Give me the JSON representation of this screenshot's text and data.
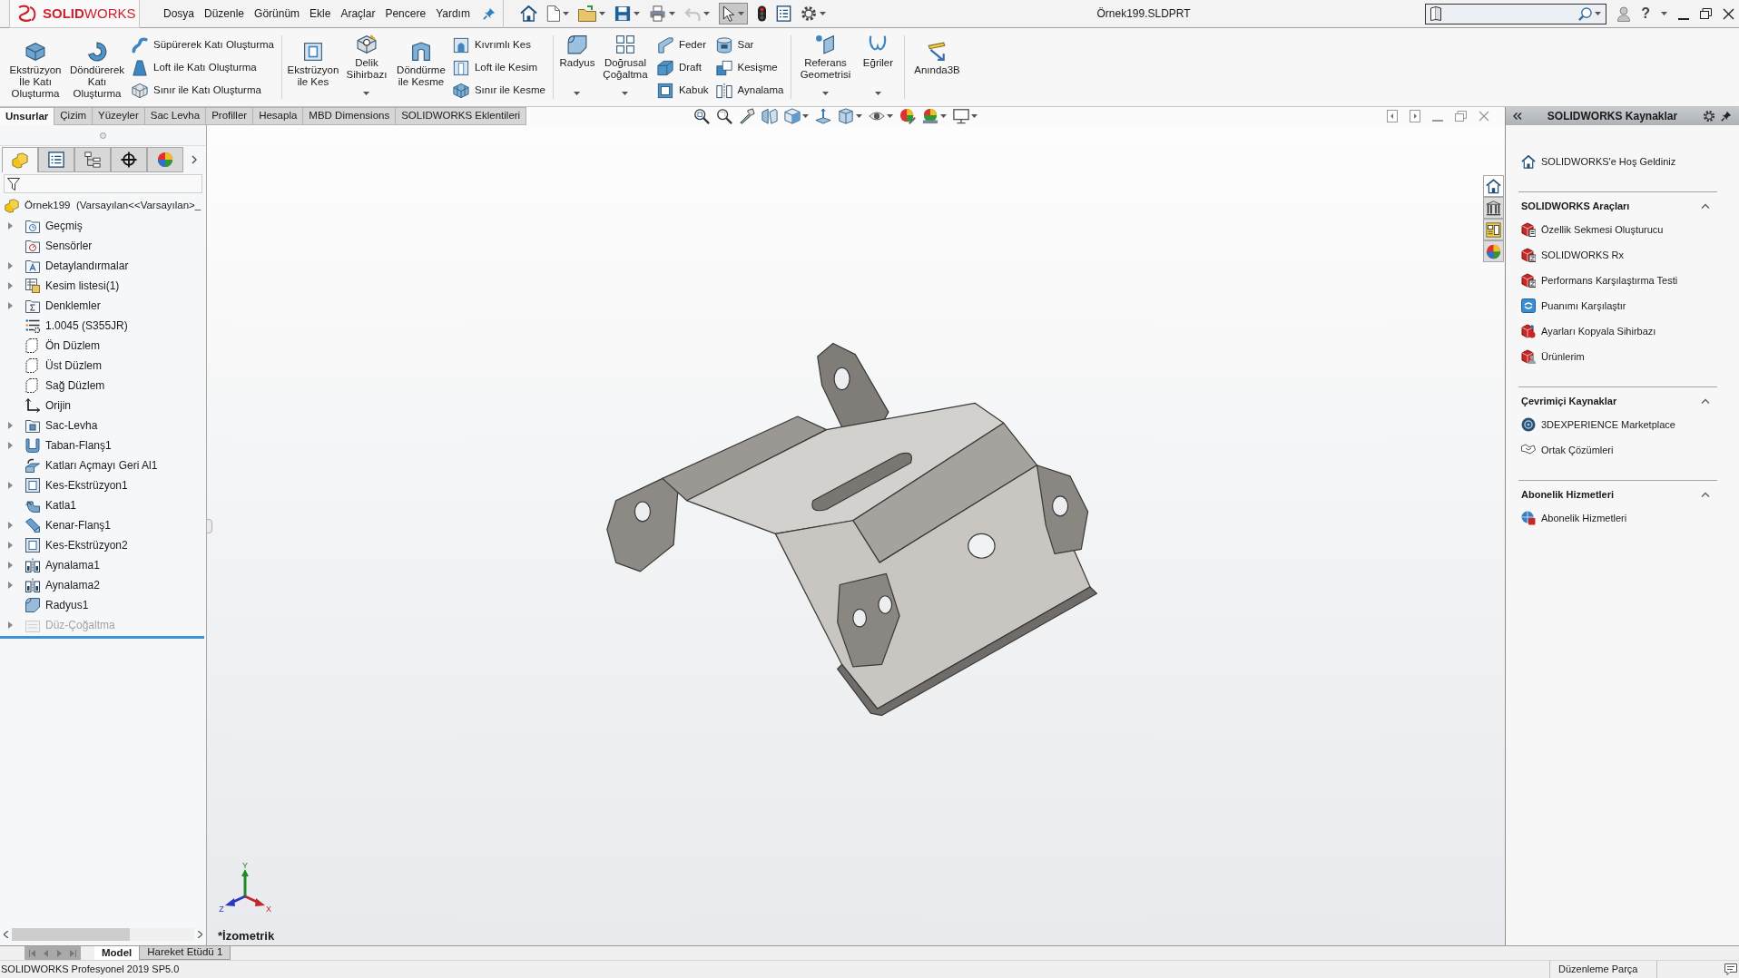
{
  "title_bar": {
    "logo": "**SOLID**WORKS",
    "menu": [
      "Dosya",
      "Düzenle",
      "Görünüm",
      "Ekle",
      "Araçlar",
      "Pencere",
      "Yardım"
    ],
    "quick_access": {
      "undo": {
        "disabled": true
      },
      "select": {
        "selected": true
      }
    },
    "document_title": "Örnek199.SLDPRT",
    "help": "?"
  },
  "ribbon": {
    "groups": [
      {
        "items": [
          {
            "kind": "large",
            "label": "Ekstrüzyon\nİle Katı\nOluşturma",
            "dropdown": false
          },
          {
            "kind": "large",
            "label": "Döndürerek\nKatı\nOluşturma",
            "dropdown": false
          },
          {
            "kind": "stack",
            "items": [
              "Süpürerek Katı Oluşturma",
              "Loft ile Katı Oluşturma",
              "Sınır ile Katı Oluşturma"
            ]
          }
        ]
      },
      {
        "items": [
          {
            "kind": "large",
            "label": "Ekstrüzyon\nile Kes",
            "dropdown": false
          },
          {
            "kind": "large",
            "label": "Delik\nSihirbazı",
            "dropdown": true
          },
          {
            "kind": "large",
            "label": "Döndürme\nile Kesme",
            "dropdown": false
          },
          {
            "kind": "stack",
            "items": [
              "Kıvrımlı Kes",
              "Loft ile Kesim",
              "Sınır ile Kesme"
            ]
          }
        ]
      },
      {
        "items": [
          {
            "kind": "large",
            "label": "Radyus",
            "dropdown": true
          },
          {
            "kind": "large",
            "label": "Doğrusal\nÇoğaltma",
            "dropdown": true
          },
          {
            "kind": "stack",
            "items": [
              "Feder",
              "Draft",
              "Kabuk"
            ]
          },
          {
            "kind": "stack",
            "items": [
              "Sar",
              "Kesişme",
              "Aynalama"
            ]
          }
        ]
      },
      {
        "items": [
          {
            "kind": "large",
            "label": "Referans\nGeometrisi",
            "dropdown": true
          },
          {
            "kind": "large",
            "label": "Eğriler",
            "dropdown": true
          }
        ]
      },
      {
        "items": [
          {
            "kind": "large",
            "label": "Anında3B",
            "dropdown": false
          }
        ]
      }
    ]
  },
  "command_tabs": [
    {
      "label": "Unsurlar",
      "selected": true
    },
    {
      "label": "Çizim",
      "selected": false
    },
    {
      "label": "Yüzeyler",
      "selected": false
    },
    {
      "label": "Sac Levha",
      "selected": false
    },
    {
      "label": "Profiller",
      "selected": false
    },
    {
      "label": "Hesapla",
      "selected": false
    },
    {
      "label": "MBD Dimensions",
      "selected": false
    },
    {
      "label": "SOLIDWORKS Eklentileri",
      "selected": false
    }
  ],
  "feature_manager": {
    "panel_tabs": [
      {
        "selected": true
      },
      {
        "selected": false
      },
      {
        "selected": false
      },
      {
        "selected": false
      },
      {
        "selected": false
      }
    ],
    "root": "Örnek199  (Varsayılan<<Varsayılan>_",
    "items": [
      {
        "label": "Geçmiş",
        "expandable": true,
        "expanded": false,
        "suppressed": false
      },
      {
        "label": "Sensörler",
        "expandable": false,
        "expanded": false,
        "suppressed": false
      },
      {
        "label": "Detaylandırmalar",
        "expandable": true,
        "expanded": false,
        "suppressed": false
      },
      {
        "label": "Kesim listesi(1)",
        "expandable": true,
        "expanded": false,
        "suppressed": false
      },
      {
        "label": "Denklemler",
        "expandable": true,
        "expanded": false,
        "suppressed": false
      },
      {
        "label": "1.0045 (S355JR)",
        "expandable": false,
        "expanded": false,
        "suppressed": false
      },
      {
        "label": "Ön Düzlem",
        "expandable": false,
        "expanded": false,
        "suppressed": false
      },
      {
        "label": "Üst Düzlem",
        "expandable": false,
        "expanded": false,
        "suppressed": false
      },
      {
        "label": "Sağ Düzlem",
        "expandable": false,
        "expanded": false,
        "suppressed": false
      },
      {
        "label": "Orijin",
        "expandable": false,
        "expanded": false,
        "suppressed": false
      },
      {
        "label": "Sac-Levha",
        "expandable": true,
        "expanded": false,
        "suppressed": false
      },
      {
        "label": "Taban-Flanş1",
        "expandable": true,
        "expanded": false,
        "suppressed": false
      },
      {
        "label": "Katları Açmayı Geri Al1",
        "expandable": false,
        "expanded": false,
        "suppressed": false
      },
      {
        "label": "Kes-Ekstrüzyon1",
        "expandable": true,
        "expanded": false,
        "suppressed": false
      },
      {
        "label": "Katla1",
        "expandable": false,
        "expanded": false,
        "suppressed": false
      },
      {
        "label": "Kenar-Flanş1",
        "expandable": true,
        "expanded": false,
        "suppressed": false
      },
      {
        "label": "Kes-Ekstrüzyon2",
        "expandable": true,
        "expanded": false,
        "suppressed": false
      },
      {
        "label": "Aynalama1",
        "expandable": true,
        "expanded": false,
        "suppressed": false
      },
      {
        "label": "Aynalama2",
        "expandable": true,
        "expanded": false,
        "suppressed": false
      },
      {
        "label": "Radyus1",
        "expandable": false,
        "expanded": false,
        "suppressed": false
      },
      {
        "label": "Düz-Çoğaltma",
        "expandable": true,
        "expanded": false,
        "suppressed": true
      }
    ]
  },
  "viewport": {
    "view_name": "*İzometrik",
    "triad": {
      "x": "X",
      "y": "Y",
      "z": "Z"
    }
  },
  "task_pane": {
    "tabs": [
      {
        "selected": true
      },
      {
        "selected": false
      },
      {
        "selected": false
      },
      {
        "selected": false
      }
    ],
    "title": "SOLIDWORKS Kaynaklar",
    "welcome": "SOLIDWORKS'e Hoş Geldiniz",
    "sections": [
      {
        "title": "SOLIDWORKS Araçları",
        "expanded": true,
        "items": [
          "Özellik Sekmesi Oluşturucu",
          "SOLIDWORKS Rx",
          "Performans Karşılaştırma Testi",
          "Puanımı Karşılaştır",
          "Ayarları Kopyala Sihirbazı",
          "Ürünlerim"
        ]
      },
      {
        "title": "Çevrimiçi Kaynaklar",
        "expanded": true,
        "items": [
          "3DEXPERIENCE Marketplace",
          "Ortak Çözümleri"
        ]
      },
      {
        "title": "Abonelik Hizmetleri",
        "expanded": true,
        "items": [
          "Abonelik Hizmetleri"
        ]
      }
    ]
  },
  "bottom_tabs": [
    {
      "label": "Model",
      "selected": true
    },
    {
      "label": "Hareket Etüdü 1",
      "selected": false
    }
  ],
  "status_bar": {
    "product": "SOLIDWORKS Profesyonel 2019 SP5.0",
    "mode": "Düzenleme Parça"
  }
}
